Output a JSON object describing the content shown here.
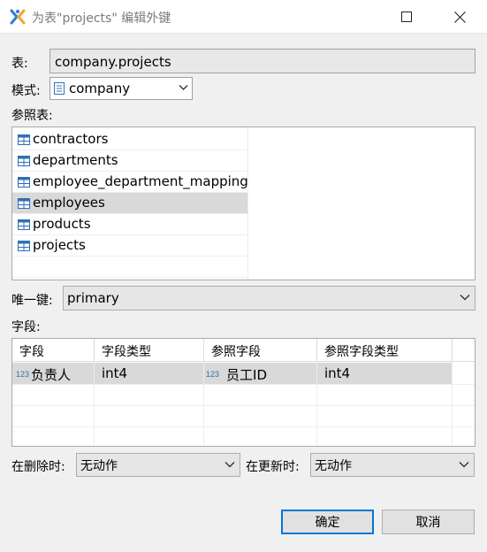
{
  "window": {
    "title": "为表\"projects\" 编辑外键"
  },
  "table": {
    "label": "表:",
    "value": "company.projects"
  },
  "schema": {
    "label": "模式:",
    "value": "company"
  },
  "ref_tables": {
    "label": "参照表:",
    "items": [
      "contractors",
      "departments",
      "employee_department_mapping",
      "employees",
      "products",
      "projects"
    ],
    "selected_index": 3
  },
  "unique_key": {
    "label": "唯一键:",
    "value": "primary"
  },
  "fields": {
    "label": "字段:",
    "columns": [
      "字段",
      "字段类型",
      "参照字段",
      "参照字段类型"
    ],
    "rows": [
      {
        "field": "负责人",
        "field_type": "int4",
        "ref_field": "员工ID",
        "ref_field_type": "int4",
        "field_icon": "123",
        "ref_icon": "123"
      }
    ]
  },
  "on_delete": {
    "label": "在删除时:",
    "value": "无动作"
  },
  "on_update": {
    "label": "在更新时:",
    "value": "无动作"
  },
  "buttons": {
    "ok": "确定",
    "cancel": "取消"
  },
  "colors": {
    "selection": "#d9d9d9",
    "accent": "#0078d7",
    "table_icon": "#2f6fb3"
  },
  "icons": {
    "app": "dbeaver-logo-icon",
    "schema": "schema-icon",
    "table": "table-icon",
    "numeric": "numeric-type-icon"
  }
}
